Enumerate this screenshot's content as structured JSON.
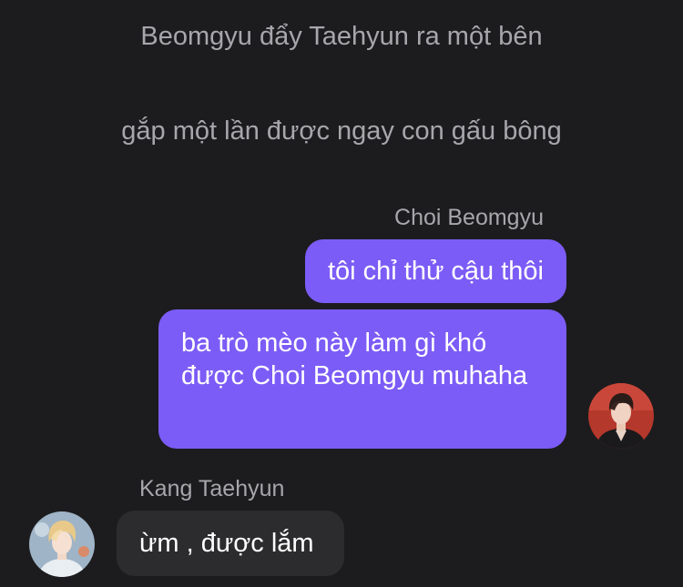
{
  "narration": [
    "Beomgyu đẩy Taehyun ra một bên",
    "gắp một lần được ngay con gấu bông"
  ],
  "messages": {
    "right_sender": "Choi Beomgyu",
    "right_bubbles": [
      "tôi chỉ thử cậu thôi",
      "ba trò mèo này làm gì khó được Choi Beomgyu muhaha"
    ],
    "left_sender": "Kang Taehyun",
    "left_bubbles": [
      "ừm , được lắm"
    ]
  },
  "colors": {
    "background": "#1c1c1e",
    "outgoing_bubble": "#7c5cf6",
    "incoming_bubble": "#2c2c2e",
    "secondary_text": "#a7a7ab"
  }
}
